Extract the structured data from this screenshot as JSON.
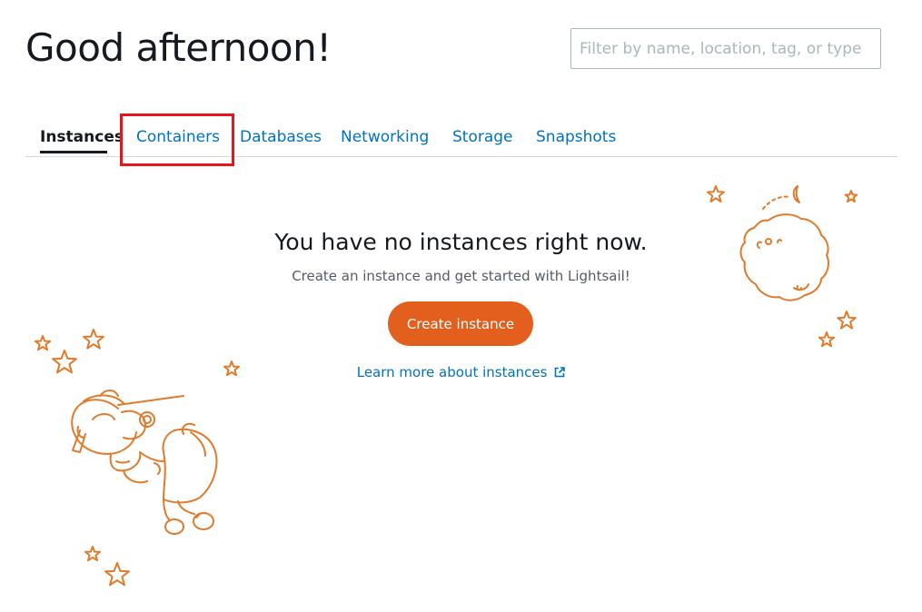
{
  "header": {
    "greeting": "Good afternoon!",
    "filter_placeholder": "Filter by name, location, tag, or type"
  },
  "tabs": [
    {
      "label": "Instances",
      "active": true
    },
    {
      "label": "Containers",
      "active": false,
      "highlighted": true
    },
    {
      "label": "Databases",
      "active": false
    },
    {
      "label": "Networking",
      "active": false
    },
    {
      "label": "Storage",
      "active": false
    },
    {
      "label": "Snapshots",
      "active": false
    }
  ],
  "empty_state": {
    "title": "You have no instances right now.",
    "subtitle": "Create an instance and get started with Lightsail!",
    "create_button": "Create instance",
    "learn_link": "Learn more about instances",
    "learn_link_icon": "external-link-icon"
  },
  "colors": {
    "accent": "#e35f1e",
    "link": "#0073bb",
    "text": "#16191f",
    "highlight": "#e8161c",
    "illustration": "#e07b2c"
  }
}
